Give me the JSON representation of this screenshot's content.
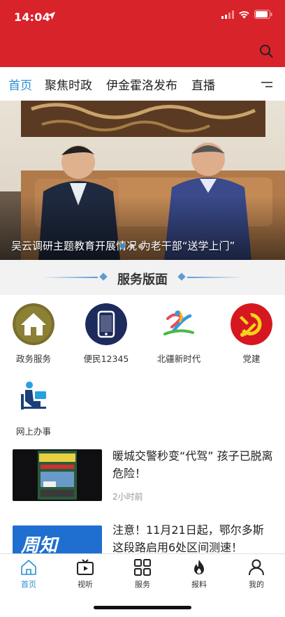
{
  "status_bar": {
    "time": "14:04"
  },
  "tabs": [
    {
      "label": "首页",
      "active": true
    },
    {
      "label": "聚焦时政",
      "active": false
    },
    {
      "label": "伊金霍洛发布",
      "active": false
    },
    {
      "label": "直播",
      "active": false
    }
  ],
  "hero": {
    "caption": "吴云调研主题教育开展情况 为老干部“送学上门”",
    "slide_count": 3,
    "current_slide": 1
  },
  "service_section": {
    "title": "服务版面"
  },
  "services": [
    {
      "label": "政务服务",
      "icon": "house-icon"
    },
    {
      "label": "便民12345",
      "icon": "phone-icon"
    },
    {
      "label": "北疆新时代",
      "icon": "beijiang-logo-icon"
    },
    {
      "label": "党建",
      "icon": "party-emblem-icon"
    },
    {
      "label": "网上办事",
      "icon": "online-service-icon"
    }
  ],
  "news": [
    {
      "title": "暖城交警秒变“代驾” 孩子已脱离危险！",
      "time": "2小时前"
    },
    {
      "title": "注意！11月21日起，鄂尔多斯这段路启用6处区间测速！",
      "time": "",
      "thumb_text": "周知"
    }
  ],
  "bottom_nav": [
    {
      "label": "首页",
      "icon": "home-icon",
      "active": true
    },
    {
      "label": "视听",
      "icon": "video-icon",
      "active": false
    },
    {
      "label": "服务",
      "icon": "grid-icon",
      "active": false
    },
    {
      "label": "报料",
      "icon": "fire-icon",
      "active": false
    },
    {
      "label": "我的",
      "icon": "user-icon",
      "active": false
    }
  ],
  "colors": {
    "header_red": "#d8232a",
    "accent_blue": "#2a8fd4",
    "section_bg": "#f2f2f2"
  }
}
